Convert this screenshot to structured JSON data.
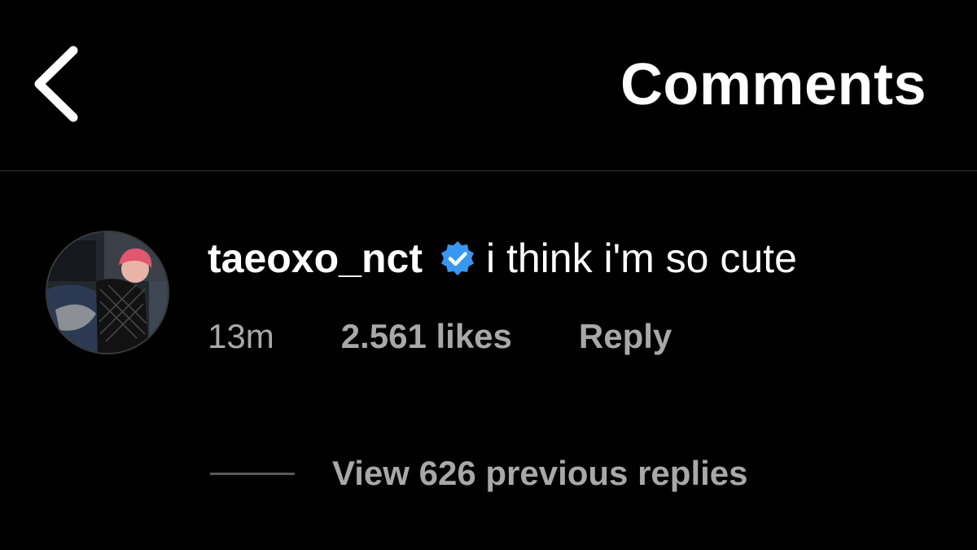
{
  "header": {
    "back_icon": "chevron-left-icon",
    "title": "Comments"
  },
  "comment": {
    "username": "taeoxo_nct",
    "verified_icon": "verified-badge-icon",
    "text": "i think i'm so cute",
    "timestamp": "13m",
    "likes": "2.561 likes",
    "reply_label": "Reply",
    "view_replies": "View 626 previous replies"
  },
  "colors": {
    "background": "#000000",
    "text_primary": "#ffffff",
    "text_secondary": "#a8a8a8",
    "verified": "#3897f0",
    "divider": "#2f2f2f"
  }
}
